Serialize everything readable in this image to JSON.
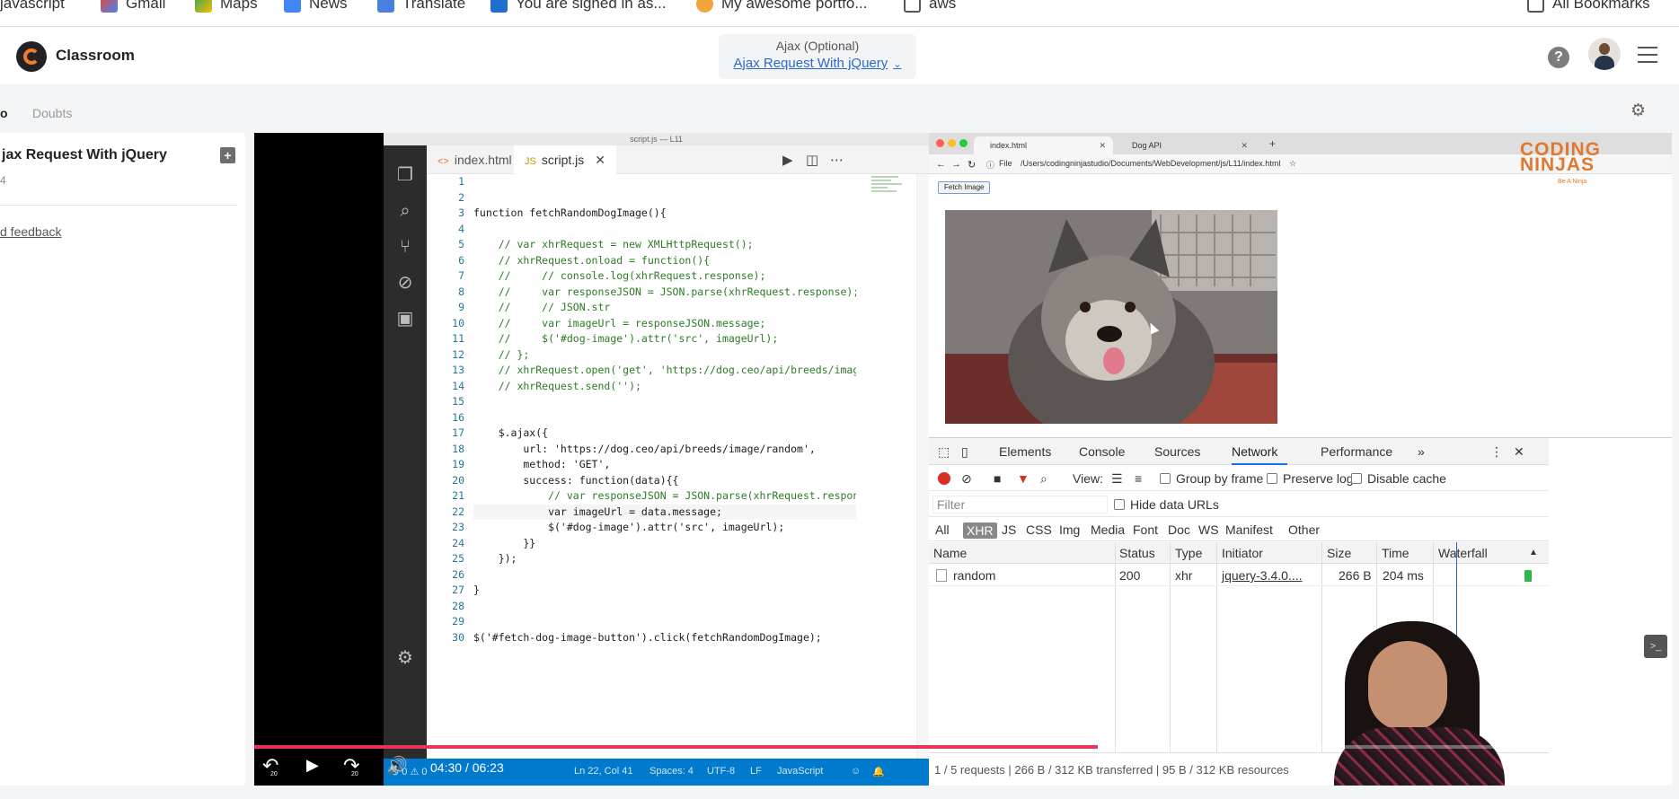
{
  "bookmarks_bar": {
    "items": [
      {
        "label": "javascript",
        "icon": "folder-icon"
      },
      {
        "label": "Gmail",
        "icon": "gmail-icon"
      },
      {
        "label": "Maps",
        "icon": "maps-icon"
      },
      {
        "label": "News",
        "icon": "news-icon"
      },
      {
        "label": "Translate",
        "icon": "translate-icon"
      },
      {
        "label": "You are signed in as...",
        "icon": "s-icon"
      },
      {
        "label": "My awesome portfo...",
        "icon": "palette-icon"
      },
      {
        "label": "aws",
        "icon": "folder-icon"
      }
    ],
    "all_bookmarks": "All Bookmarks"
  },
  "header": {
    "brand": "Classroom",
    "course_section": "Ajax (Optional)",
    "course_lesson": "Ajax Request With jQuery",
    "help_icon": "?",
    "menu_icon": "hamburger-icon"
  },
  "tabs": {
    "video": "o",
    "doubts": "Doubts"
  },
  "sidebar": {
    "lesson_title": "jax Request With jQuery",
    "lesson_number": "4",
    "feedback": "d feedback"
  },
  "vscode": {
    "title": "script.js — L11",
    "tabs": [
      {
        "badge": "<>",
        "label": "index.html"
      },
      {
        "badge": "JS",
        "label": "script.js",
        "close": "✕"
      }
    ],
    "line_numbers": [
      "1",
      "2",
      "3",
      "4",
      "5",
      "6",
      "7",
      "8",
      "9",
      "10",
      "11",
      "12",
      "13",
      "14",
      "15",
      "16",
      "17",
      "18",
      "19",
      "20",
      "21",
      "22",
      "23",
      "24",
      "25",
      "26",
      "27",
      "28",
      "29",
      "30"
    ],
    "code_lines": [
      "",
      "",
      "function fetchRandomDogImage(){",
      "",
      "    // var xhrRequest = new XMLHttpRequest();",
      "    // xhrRequest.onload = function(){",
      "    //     // console.log(xhrRequest.response);",
      "    //     var responseJSON = JSON.parse(xhrRequest.response);",
      "    //     // JSON.str",
      "    //     var imageUrl = responseJSON.message;",
      "    //     $('#dog-image').attr('src', imageUrl);",
      "    // };",
      "    // xhrRequest.open('get', 'https://dog.ceo/api/breeds/image",
      "    // xhrRequest.send('');",
      "",
      "",
      "    $.ajax({",
      "        url: 'https://dog.ceo/api/breeds/image/random',",
      "        method: 'GET',",
      "        success: function(data){{",
      "            // var responseJSON = JSON.parse(xhrRequest.respons",
      "            var imageUrl = data.message;",
      "            $('#dog-image').attr('src', imageUrl);",
      "        }}",
      "    });",
      "",
      "}",
      "",
      "",
      "$('#fetch-dog-image-button').click(fetchRandomDogImage);"
    ],
    "status": {
      "errors": "⊗ 0 ⚠ 0",
      "cursor": "Ln 22, Col 41",
      "spaces": "Spaces: 4",
      "encoding": "UTF-8",
      "eol": "LF",
      "language": "JavaScript"
    }
  },
  "chrome": {
    "tabs": [
      {
        "label": "index.html",
        "close": "✕"
      },
      {
        "label": "Dog API",
        "close": "✕"
      }
    ],
    "new_tab": "+",
    "file_label": "File",
    "url": "/Users/codingninjastudio/Documents/WebDevelopment/js/L11/index.html",
    "fetch_button": "Fetch Image",
    "watermark_line1": "CODING",
    "watermark_line2": "NINJAS",
    "watermark_tagline": "Be A Ninja"
  },
  "devtools": {
    "tabs": [
      "Elements",
      "Console",
      "Sources",
      "Network",
      "Performance"
    ],
    "more": "»",
    "active_tab": "Network",
    "view_label": "View:",
    "group_by_frame": "Group by frame",
    "preserve_log": "Preserve log",
    "disable_cache": "Disable cache",
    "filter_placeholder": "Filter",
    "hide_data_urls": "Hide data URLs",
    "types": [
      "All",
      "XHR",
      "JS",
      "CSS",
      "Img",
      "Media",
      "Font",
      "Doc",
      "WS",
      "Manifest",
      "Other"
    ],
    "columns": [
      "Name",
      "Status",
      "Type",
      "Initiator",
      "Size",
      "Time",
      "Waterfall"
    ],
    "rows": [
      {
        "name": "random",
        "status": "200",
        "type": "xhr",
        "initiator": "jquery-3.4.0....",
        "size": "266 B",
        "time": "204 ms"
      }
    ],
    "status_bar": "1 / 5 requests | 266 B / 312 KB transferred | 95 B / 312 KB resources"
  },
  "player": {
    "current_time": "04:30",
    "duration": "06:23",
    "time_display": "04:30 / 06:23",
    "progress": 0.595,
    "skip_seconds": "20"
  },
  "colors": {
    "accent": "#2a6ad1",
    "progress": "#e8325a",
    "vscode_status": "#007acc",
    "record": "#d93025"
  }
}
